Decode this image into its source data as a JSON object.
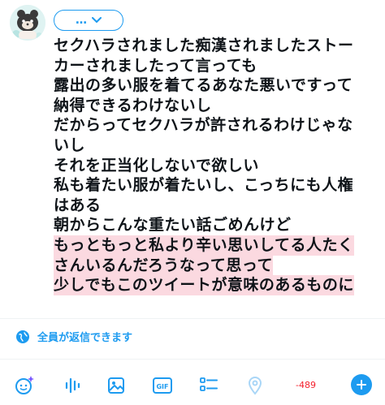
{
  "composer": {
    "audience_label": "…",
    "tweet_lines": [
      "セクハラされました痴漢されましたストー",
      "カーされましたって言っても",
      "露出の多い服を着てるあなた悪いですって",
      "納得できるわけないし",
      "だからってセクハラが許されるわけじゃな",
      "いし",
      "それを正当化しないで欲しい",
      "私も着たい服が着たいし、こっちにも人権",
      "はある",
      "朝からこんな重たい話ごめんけど"
    ],
    "overflow_lines": [
      "もっともっと私より辛い思いしてる人たく",
      "さんいるんだろうなって思って",
      "少しでもこのツイートが意味のあるものに"
    ],
    "reply_setting_label": "全員が返信できます",
    "character_count": "-489"
  },
  "toolbar": {
    "gif_label": "GIF",
    "icons": [
      "sparkle-ai-icon",
      "audio-wave-icon",
      "image-icon",
      "gif-icon",
      "poll-icon",
      "location-icon"
    ]
  },
  "colors": {
    "accent": "#1d9bf0",
    "overflow_highlight": "#fbd9e0",
    "count_negative": "#f4212e"
  }
}
